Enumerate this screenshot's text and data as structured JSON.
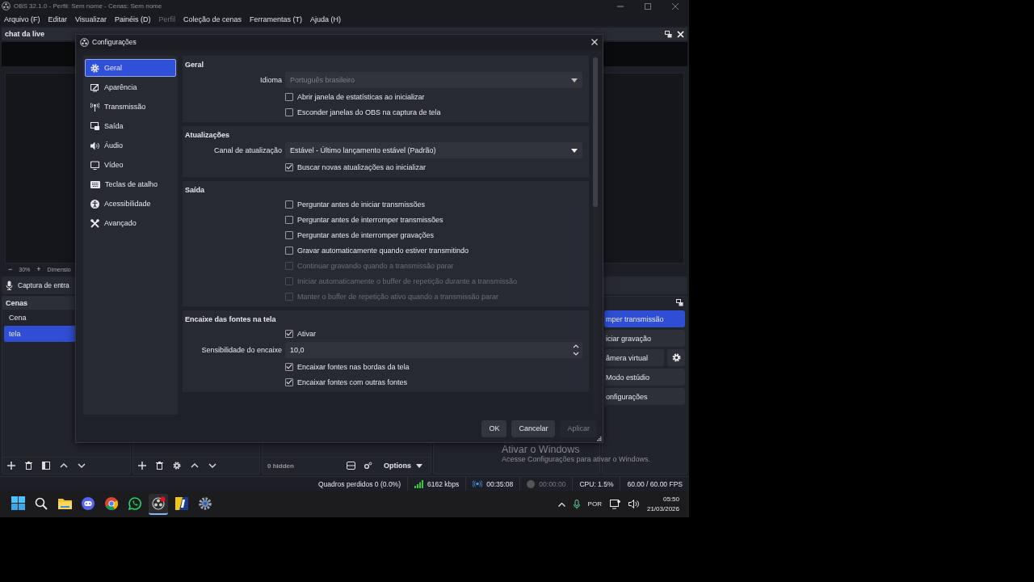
{
  "window": {
    "title": "OBS 32.1.0 - Perfil: Sem nome - Cenas: Sem nome"
  },
  "menu": [
    {
      "label": "Arquivo (F)",
      "disabled": false
    },
    {
      "label": "Editar",
      "disabled": false
    },
    {
      "label": "Visualizar",
      "disabled": false
    },
    {
      "label": "Painéis (D)",
      "disabled": false
    },
    {
      "label": "Perfil",
      "disabled": true
    },
    {
      "label": "Coleção de cenas",
      "disabled": false
    },
    {
      "label": "Ferramentas (T)",
      "disabled": false
    },
    {
      "label": "Ajuda (H)",
      "disabled": false
    }
  ],
  "chat_dock": {
    "title": "chat da live"
  },
  "preview": {
    "zoom_out": "−",
    "zoom": "30%",
    "zoom_in": "+",
    "size_label": "Dimensio"
  },
  "mixer": {
    "source": "Captura de entra"
  },
  "scenes": {
    "title": "Cenas",
    "items": [
      {
        "label": "Cena",
        "selected": false
      },
      {
        "label": "tela",
        "selected": true
      }
    ]
  },
  "sources": {
    "hidden": "0 hidden",
    "options": "Options"
  },
  "controls": [
    {
      "label": "mper transmissão",
      "kind": "primary"
    },
    {
      "label": "iciar gravação",
      "kind": "plain"
    },
    {
      "label": "âmera virtual",
      "kind": "split"
    },
    {
      "label": "Modo estúdio",
      "kind": "plain"
    },
    {
      "label": "onfigurações",
      "kind": "plain"
    }
  ],
  "status_bar": {
    "dropped": "Quadros perdidos 0 (0.0%)",
    "bitrate": "6162 kbps",
    "stream_time": "00:35:08",
    "record_time": "00:00:00",
    "recording": false,
    "cpu": "CPU: 1.5%",
    "fps": "60.00 / 60.00 FPS"
  },
  "activation": {
    "title": "Ativar o Windows",
    "message": "Acesse Configurações para ativar o Windows."
  },
  "taskbar": {
    "apps": [
      {
        "kind": "start",
        "active": false
      },
      {
        "kind": "search",
        "active": false
      },
      {
        "kind": "files",
        "active": false
      },
      {
        "kind": "chat",
        "active": false
      },
      {
        "kind": "browser",
        "active": false
      },
      {
        "kind": "phone",
        "active": false
      },
      {
        "kind": "recorder",
        "active": true
      },
      {
        "kind": "game",
        "active": false
      },
      {
        "kind": "settings",
        "active": false
      }
    ],
    "language": "POR",
    "time": "05:50",
    "date": "21/03/2026"
  },
  "dialog": {
    "title": "Configurações",
    "nav": [
      {
        "label": "Geral",
        "kind": "gear",
        "selected": true
      },
      {
        "label": "Aparência",
        "kind": "appearance",
        "selected": false
      },
      {
        "label": "Transmissão",
        "kind": "antenna",
        "selected": false
      },
      {
        "label": "Saída",
        "kind": "output",
        "selected": false
      },
      {
        "label": "Áudio",
        "kind": "audio",
        "selected": false
      },
      {
        "label": "Vídeo",
        "kind": "video",
        "selected": false
      },
      {
        "label": "Teclas de atalho",
        "kind": "keyboard",
        "selected": false
      },
      {
        "label": "Acessibilidade",
        "kind": "access",
        "selected": false
      },
      {
        "label": "Avançado",
        "kind": "tools",
        "selected": false
      }
    ],
    "sections": [
      {
        "title": "Geral",
        "rows": [
          {
            "kind": "select",
            "label": "Idioma",
            "value": "Português brasileiro",
            "disabled": true
          },
          {
            "kind": "checkbox",
            "label": "Abrir janela de estatísticas ao inicializar",
            "checked": false,
            "disabled": false
          },
          {
            "kind": "checkbox",
            "label": "Esconder janelas do OBS na captura de tela",
            "checked": false,
            "disabled": false
          }
        ]
      },
      {
        "title": "Atualizações",
        "rows": [
          {
            "kind": "select",
            "label": "Canal de atualização",
            "value": "Estável - Último lançamento estável (Padrão)",
            "disabled": false
          },
          {
            "kind": "checkbox",
            "label": "Buscar novas atualizações ao inicializar",
            "checked": true,
            "disabled": false
          }
        ]
      },
      {
        "title": "Saída",
        "rows": [
          {
            "kind": "checkbox",
            "label": "Perguntar antes de iniciar transmissões",
            "checked": false,
            "disabled": false
          },
          {
            "kind": "checkbox",
            "label": "Perguntar antes de interromper transmissões",
            "checked": false,
            "disabled": false
          },
          {
            "kind": "checkbox",
            "label": "Perguntar antes de interromper gravações",
            "checked": false,
            "disabled": false
          },
          {
            "kind": "checkbox",
            "label": "Gravar automaticamente quando estiver transmitindo",
            "checked": false,
            "disabled": false
          },
          {
            "kind": "checkbox",
            "label": "Continuar gravando quando a transmissão parar",
            "checked": false,
            "disabled": true
          },
          {
            "kind": "checkbox",
            "label": "Iniciar automaticamente o buffer de repetição durante a transmissão",
            "checked": false,
            "disabled": true
          },
          {
            "kind": "checkbox",
            "label": "Manter o buffer de repetição ativo quando a transmissão parar",
            "checked": false,
            "disabled": true
          }
        ]
      },
      {
        "title": "Encaixe das fontes na tela",
        "rows": [
          {
            "kind": "checkbox",
            "label": "Ativar",
            "checked": true,
            "disabled": false
          },
          {
            "kind": "spin",
            "label": "Sensibilidade do encaixe",
            "value": "10,0",
            "disabled": false
          },
          {
            "kind": "checkbox",
            "label": "Encaixar fontes nas bordas da tela",
            "checked": true,
            "disabled": false
          },
          {
            "kind": "checkbox",
            "label": "Encaixar fontes com outras fontes",
            "checked": true,
            "disabled": false
          }
        ]
      }
    ],
    "buttons": [
      {
        "label": "OK",
        "disabled": false
      },
      {
        "label": "Cancelar",
        "disabled": false
      },
      {
        "label": "Aplicar",
        "disabled": true
      }
    ]
  }
}
